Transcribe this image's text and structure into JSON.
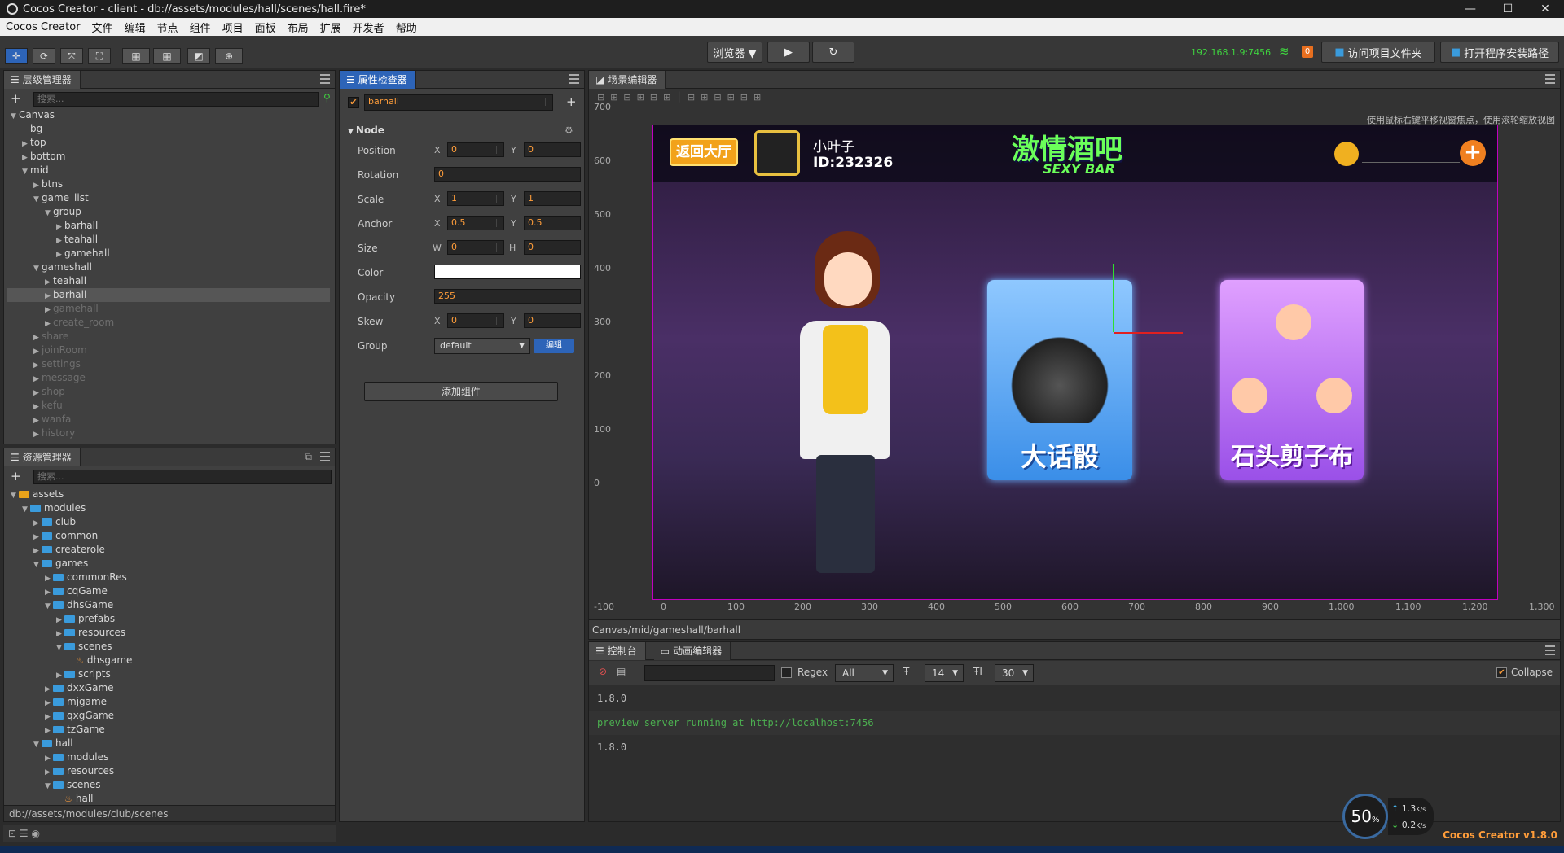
{
  "window": {
    "title": "Cocos Creator - client - db://assets/modules/hall/scenes/hall.fire*",
    "min": "—",
    "max": "☐",
    "close": "✕"
  },
  "menu": [
    "Cocos Creator",
    "文件",
    "编辑",
    "节点",
    "组件",
    "项目",
    "面板",
    "布局",
    "扩展",
    "开发者",
    "帮助"
  ],
  "toolbar": {
    "browser": "浏览器 ▼",
    "play": "▶",
    "refresh": "↻",
    "ip": "192.168.1.9:7456",
    "wifi_badge": "0",
    "open_project": "访问项目文件夹",
    "open_install": "打开程序安装路径",
    "tools": [
      "✛",
      "⟳",
      "⤧",
      "⛶"
    ],
    "extra": [
      "▦",
      "▦",
      "◩",
      "⊕"
    ]
  },
  "hierarchy": {
    "title": "层级管理器",
    "search_placeholder": "搜索...",
    "rows": [
      {
        "label": "Canvas",
        "depth": 0,
        "arrow": "▼",
        "dim": false
      },
      {
        "label": "bg",
        "depth": 1,
        "arrow": "",
        "dim": false
      },
      {
        "label": "top",
        "depth": 1,
        "arrow": "▶",
        "dim": false
      },
      {
        "label": "bottom",
        "depth": 1,
        "arrow": "▶",
        "dim": false
      },
      {
        "label": "mid",
        "depth": 1,
        "arrow": "▼",
        "dim": false
      },
      {
        "label": "btns",
        "depth": 2,
        "arrow": "▶",
        "dim": false
      },
      {
        "label": "game_list",
        "depth": 2,
        "arrow": "▼",
        "dim": false
      },
      {
        "label": "group",
        "depth": 3,
        "arrow": "▼",
        "dim": false
      },
      {
        "label": "barhall",
        "depth": 4,
        "arrow": "▶",
        "dim": false
      },
      {
        "label": "teahall",
        "depth": 4,
        "arrow": "▶",
        "dim": false
      },
      {
        "label": "gamehall",
        "depth": 4,
        "arrow": "▶",
        "dim": false
      },
      {
        "label": "gameshall",
        "depth": 2,
        "arrow": "▼",
        "dim": false
      },
      {
        "label": "teahall",
        "depth": 3,
        "arrow": "▶",
        "dim": false
      },
      {
        "label": "barhall",
        "depth": 3,
        "arrow": "▶",
        "dim": false,
        "sel": true
      },
      {
        "label": "gamehall",
        "depth": 3,
        "arrow": "▶",
        "dim": true
      },
      {
        "label": "create_room",
        "depth": 3,
        "arrow": "▶",
        "dim": true
      },
      {
        "label": "share",
        "depth": 2,
        "arrow": "▶",
        "dim": true
      },
      {
        "label": "joinRoom",
        "depth": 2,
        "arrow": "▶",
        "dim": true
      },
      {
        "label": "settings",
        "depth": 2,
        "arrow": "▶",
        "dim": true
      },
      {
        "label": "message",
        "depth": 2,
        "arrow": "▶",
        "dim": true
      },
      {
        "label": "shop",
        "depth": 2,
        "arrow": "▶",
        "dim": true
      },
      {
        "label": "kefu",
        "depth": 2,
        "arrow": "▶",
        "dim": true
      },
      {
        "label": "wanfa",
        "depth": 2,
        "arrow": "▶",
        "dim": true
      },
      {
        "label": "history",
        "depth": 2,
        "arrow": "▶",
        "dim": true
      }
    ]
  },
  "assets": {
    "title": "资源管理器",
    "search_placeholder": "搜索...",
    "status": "db://assets/modules/club/scenes",
    "rows": [
      {
        "label": "assets",
        "depth": 0,
        "arrow": "▼",
        "type": "db"
      },
      {
        "label": "modules",
        "depth": 1,
        "arrow": "▼",
        "type": "folder"
      },
      {
        "label": "club",
        "depth": 2,
        "arrow": "▶",
        "type": "folder"
      },
      {
        "label": "common",
        "depth": 2,
        "arrow": "▶",
        "type": "folder"
      },
      {
        "label": "createrole",
        "depth": 2,
        "arrow": "▶",
        "type": "folder"
      },
      {
        "label": "games",
        "depth": 2,
        "arrow": "▼",
        "type": "folder"
      },
      {
        "label": "commonRes",
        "depth": 3,
        "arrow": "▶",
        "type": "folder"
      },
      {
        "label": "cqGame",
        "depth": 3,
        "arrow": "▶",
        "type": "folder"
      },
      {
        "label": "dhsGame",
        "depth": 3,
        "arrow": "▼",
        "type": "folder"
      },
      {
        "label": "prefabs",
        "depth": 4,
        "arrow": "▶",
        "type": "folder"
      },
      {
        "label": "resources",
        "depth": 4,
        "arrow": "▶",
        "type": "folder"
      },
      {
        "label": "scenes",
        "depth": 4,
        "arrow": "▼",
        "type": "folder"
      },
      {
        "label": "dhsgame",
        "depth": 5,
        "arrow": "",
        "type": "scene"
      },
      {
        "label": "scripts",
        "depth": 4,
        "arrow": "▶",
        "type": "folder"
      },
      {
        "label": "dxxGame",
        "depth": 3,
        "arrow": "▶",
        "type": "folder"
      },
      {
        "label": "mjgame",
        "depth": 3,
        "arrow": "▶",
        "type": "folder"
      },
      {
        "label": "qxgGame",
        "depth": 3,
        "arrow": "▶",
        "type": "folder"
      },
      {
        "label": "tzGame",
        "depth": 3,
        "arrow": "▶",
        "type": "folder"
      },
      {
        "label": "hall",
        "depth": 2,
        "arrow": "▼",
        "type": "folder"
      },
      {
        "label": "modules",
        "depth": 3,
        "arrow": "▶",
        "type": "folder"
      },
      {
        "label": "resources",
        "depth": 3,
        "arrow": "▶",
        "type": "folder"
      },
      {
        "label": "scenes",
        "depth": 3,
        "arrow": "▼",
        "type": "folder"
      },
      {
        "label": "hall",
        "depth": 4,
        "arrow": "",
        "type": "scene"
      }
    ]
  },
  "inspector": {
    "title": "属性检查器",
    "node_name": "barhall",
    "section": "Node",
    "add_component": "添加组件",
    "position": {
      "label": "Position",
      "x": "0",
      "y": "0"
    },
    "rotation": {
      "label": "Rotation",
      "value": "0"
    },
    "scale": {
      "label": "Scale",
      "x": "1",
      "y": "1"
    },
    "anchor": {
      "label": "Anchor",
      "x": "0.5",
      "y": "0.5"
    },
    "size": {
      "label": "Size",
      "w": "0",
      "h": "0"
    },
    "color": {
      "label": "Color",
      "value": "#ffffff"
    },
    "opacity": {
      "label": "Opacity",
      "value": "255"
    },
    "skew": {
      "label": "Skew",
      "x": "0",
      "y": "0"
    },
    "group": {
      "label": "Group",
      "value": "default",
      "edit": "编辑"
    },
    "axis": {
      "x": "X",
      "y": "Y",
      "w": "W",
      "h": "H"
    }
  },
  "scene": {
    "title": "场景编辑器",
    "hint": "使用鼠标右键平移视窗焦点，使用滚轮缩放视图",
    "path": "Canvas/mid/gameshall/barhall",
    "y_ticks": [
      "700",
      "600",
      "500",
      "400",
      "300",
      "200",
      "100",
      "0"
    ],
    "x_ticks": [
      "-100",
      "0",
      "100",
      "200",
      "300",
      "400",
      "500",
      "600",
      "700",
      "800",
      "900",
      "1,000",
      "1,100",
      "1,200",
      "1,300"
    ],
    "game": {
      "back": "返回大厅",
      "name": "小叶子",
      "id": "ID:232326",
      "logo": "激情酒吧",
      "logo_sub": "SEXY BAR",
      "card1": "大话骰",
      "card2": "石头剪子布",
      "plus": "+"
    }
  },
  "console": {
    "tab1": "控制台",
    "tab2": "动画编辑器",
    "regex": "Regex",
    "level": "All",
    "font_label": "14",
    "line_label": "30",
    "collapse": "Collapse",
    "lines": [
      {
        "text": "1.8.0",
        "color": "#bbbbbb"
      },
      {
        "text": "preview server running at http://localhost:7456",
        "color": "#4caf50"
      },
      {
        "text": "1.8.0",
        "color": "#bbbbbb"
      }
    ]
  },
  "net": {
    "percent": "50",
    "unit": "%",
    "up": "1.3",
    "down": "0.2",
    "rate_unit": "K/s"
  },
  "version": "Cocos Creator v1.8.0"
}
